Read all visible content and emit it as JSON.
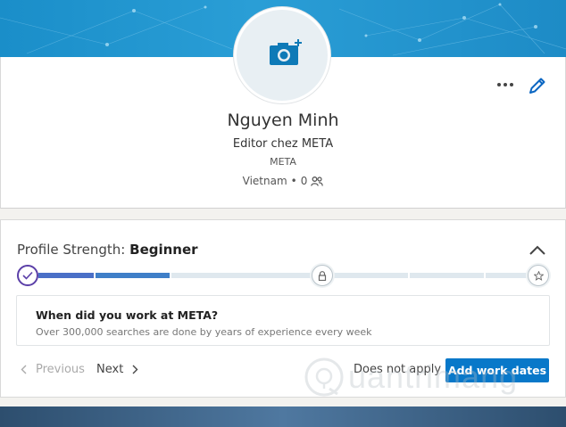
{
  "profile": {
    "name": "Nguyen Minh",
    "headline": "Editor chez META",
    "company": "META",
    "location": "Vietnam",
    "connections_sep": "•",
    "connections_count": "0"
  },
  "icons": {
    "camera": "camera-plus-icon",
    "more": "more-horizontal-icon",
    "edit": "pencil-icon",
    "collapse": "chevron-up-icon",
    "check": "checkmark-icon",
    "lock": "lock-icon",
    "star": "star-icon",
    "people": "people-icon"
  },
  "strength": {
    "label": "Profile Strength:",
    "level": "Beginner",
    "progress": 0.33
  },
  "question": {
    "title": "When did you work at META?",
    "subtitle": "Over 300,000 searches are done by years of experience every week"
  },
  "actions": {
    "previous": "Previous",
    "next": "Next",
    "not_apply": "Does not apply",
    "add": "Add work dates"
  },
  "watermark": {
    "text": "uantrimang"
  },
  "colors": {
    "accent": "#0878c9",
    "progress_start": "#5b3fa8",
    "progress_fill": "#4a6fc7"
  }
}
